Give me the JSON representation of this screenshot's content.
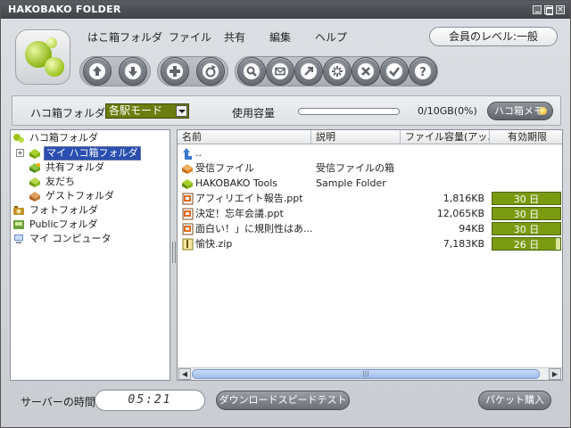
{
  "window": {
    "title": "HAKOBAKO FOLDER"
  },
  "menu": [
    "はこ箱フォルダ",
    "ファイル",
    "共有",
    "編集",
    "ヘルプ"
  ],
  "level_button": "会員のレベル:一般",
  "toolbar_icons": [
    "arrow-up-icon",
    "arrow-down-icon",
    "plus-icon",
    "share-icon",
    "magnify-icon",
    "mail-icon",
    "export-icon",
    "settings-icon",
    "delete-icon",
    "check-icon",
    "help-icon"
  ],
  "pathbar": {
    "folder_label": "ハコ箱フォルダ",
    "mode_value": "各駅モード",
    "usage_label": "使用容量",
    "usage_value": "0/10GB(0%)",
    "usage_fraction": 0,
    "memo_label": "ハコ箱メモ"
  },
  "tree": [
    {
      "label": "ハコ箱フォルダ",
      "icon": "hakobako-icon",
      "depth": 0,
      "selected": false
    },
    {
      "label": "マイ ハコ箱フォルダ",
      "icon": "my-box-folder-icon",
      "depth": 1,
      "selected": true
    },
    {
      "label": "共有フォルダ",
      "icon": "shared-folder-icon",
      "depth": 1,
      "selected": false
    },
    {
      "label": "友だち",
      "icon": "friends-icon",
      "depth": 1,
      "selected": false
    },
    {
      "label": "ゲストフォルダ",
      "icon": "guest-folder-icon",
      "depth": 1,
      "selected": false
    },
    {
      "label": "フォトフォルダ",
      "icon": "photo-folder-icon",
      "depth": 0,
      "selected": false
    },
    {
      "label": "Publicフォルダ",
      "icon": "public-folder-icon",
      "depth": 0,
      "selected": false
    },
    {
      "label": "マイ コンピュータ",
      "icon": "my-computer-icon",
      "depth": 0,
      "selected": false
    }
  ],
  "list": {
    "columns": [
      "名前",
      "説明",
      "ファイル容量(アッ...",
      "有効期限"
    ],
    "rows": [
      {
        "icon": "parent-dir-icon",
        "name": "..",
        "desc": "",
        "size": "",
        "expiry": ""
      },
      {
        "icon": "inbox-folder-icon",
        "name": "受信ファイル",
        "desc": "受信ファイルの箱",
        "size": "",
        "expiry": ""
      },
      {
        "icon": "tools-folder-icon",
        "name": "HAKOBAKO Tools",
        "desc": "Sample Folder",
        "size": "",
        "expiry": ""
      },
      {
        "icon": "ppt-file-icon",
        "name": "アフィリエイト報告.ppt",
        "desc": "",
        "size": "1,816KB",
        "expiry": "30 日",
        "expiry_fraction": 1.0
      },
      {
        "icon": "ppt-file-icon",
        "name": "決定！忘年会議.ppt",
        "desc": "",
        "size": "12,065KB",
        "expiry": "30 日",
        "expiry_fraction": 1.0
      },
      {
        "icon": "ppt-file-icon",
        "name": "面白い！」に規則性はあ...",
        "desc": "",
        "size": "94KB",
        "expiry": "30 日",
        "expiry_fraction": 1.0
      },
      {
        "icon": "zip-file-icon",
        "name": "愉快.zip",
        "desc": "",
        "size": "7,183KB",
        "expiry": "26 日",
        "expiry_fraction": 0.93
      }
    ]
  },
  "status": {
    "server_time_label": "サーバーの時間",
    "server_time": "05:21",
    "speed_test_label": "ダウンロードスピードテスト",
    "packet_label": "パケット購入"
  },
  "colors": {
    "accent_green": "#7a9a12",
    "selection_blue": "#2b4fb0"
  }
}
